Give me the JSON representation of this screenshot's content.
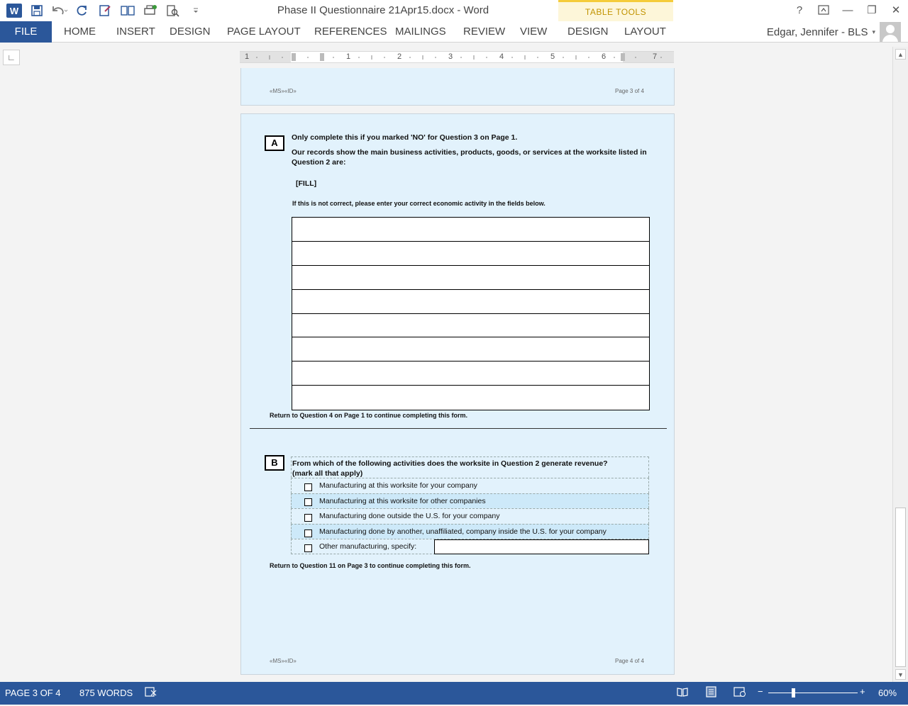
{
  "window": {
    "title": "Phase II Questionnaire 21Apr15.docx - Word",
    "contextual_group": "TABLE TOOLS",
    "controls": {
      "help": "?",
      "minimize": "—",
      "restore": "❐",
      "close": "✕"
    }
  },
  "ribbon": {
    "tabs": [
      "FILE",
      "HOME",
      "INSERT",
      "DESIGN",
      "PAGE LAYOUT",
      "REFERENCES",
      "MAILINGS",
      "REVIEW",
      "VIEW",
      "DESIGN",
      "LAYOUT"
    ],
    "user": "Edgar, Jennifer - BLS"
  },
  "ruler": {
    "numbers": [
      "1",
      "1",
      "2",
      "3",
      "4",
      "5",
      "6",
      "7"
    ]
  },
  "page3_footer": {
    "left": "«MS»«ID»",
    "right": "Page 3 of 4"
  },
  "section_a": {
    "box": "A",
    "line1": "Only complete this if you marked 'NO' for Question 3 on Page 1.",
    "line2": "Our records show the main business activities, products, goods, or services at the worksite listed in Question 2 are:",
    "fill": "[FILL]",
    "instruction": "If this is not correct, please enter your correct economic activity in the fields below.",
    "rows": 8,
    "return": "Return to Question 4 on Page 1 to continue completing this form."
  },
  "section_b": {
    "box": "B",
    "question": "From which of the following activities does the worksite in Question 2 generate revenue?",
    "hint": "(mark all that apply)",
    "options": [
      "Manufacturing at this worksite for your company",
      "Manufacturing at this worksite for other companies",
      "Manufacturing done outside the U.S. for your company",
      "Manufacturing done by another, unaffiliated, company inside the U.S. for your company",
      "Other manufacturing, specify:"
    ],
    "return": "Return to Question 11 on Page 3 to continue completing this form."
  },
  "page4_footer": {
    "left": "«MS»«ID»",
    "right": "Page 4 of 4"
  },
  "status": {
    "page": "PAGE 3 OF 4",
    "words": "875 WORDS",
    "zoom": "60%",
    "zoom_level": 0.6
  },
  "colors": {
    "accent": "#2b579a",
    "page": "#e2f2fc",
    "table_tools": "#c19300"
  }
}
